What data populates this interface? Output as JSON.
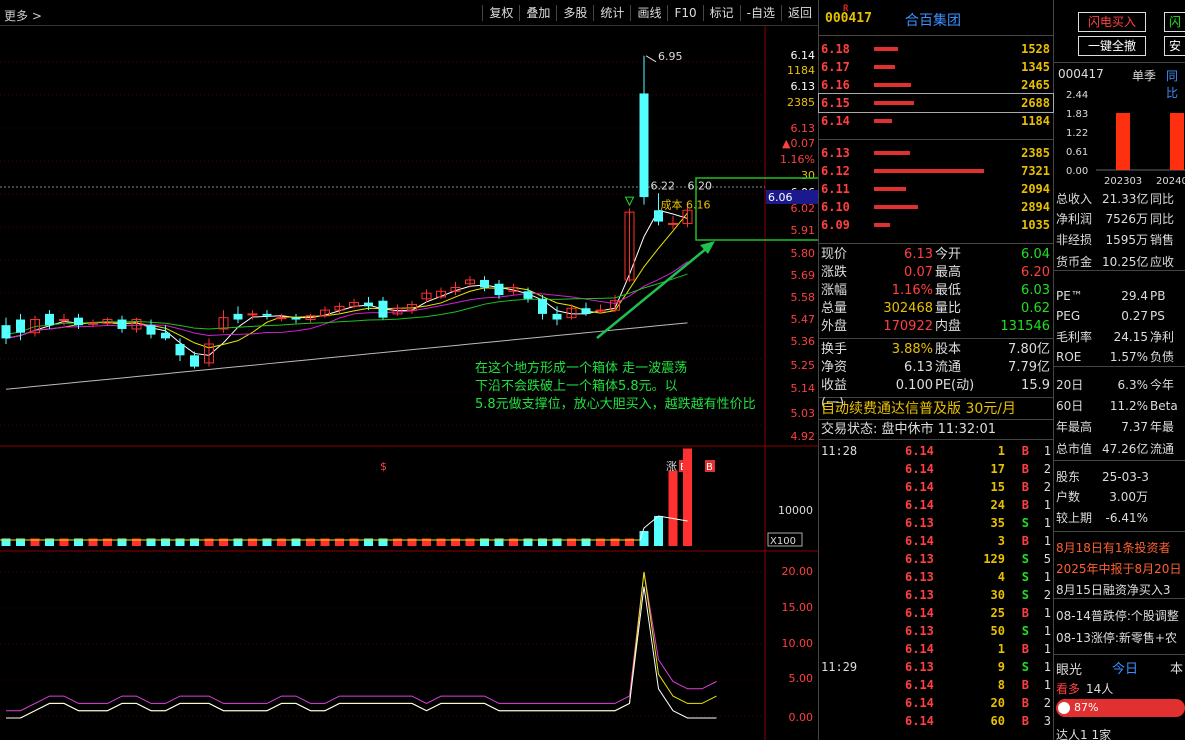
{
  "toolbar": {
    "more": "更多 >",
    "buttons": [
      "复权",
      "叠加",
      "多股",
      "统计",
      "画线",
      "F10",
      "标记",
      "-自选",
      "返回"
    ]
  },
  "chart_data": [
    {
      "type": "candlestick",
      "price_axis_ticks": [
        "6.14",
        "1184",
        "6.13",
        "2385",
        "6.13",
        "▲0.07",
        "1.16%",
        "30",
        "6.06",
        "6.02",
        "5.91",
        "5.80",
        "5.69",
        "5.58",
        "5.47",
        "5.36",
        "5.25",
        "5.14",
        "5.03",
        "4.92"
      ],
      "last_price_tag": "6.06",
      "annotations": {
        "high_label": "6.95",
        "recent_high_label": "6.22",
        "recent_high_label2": "6.20",
        "cost_label": "成本 6.16",
        "note": [
          "在这个地方形成一个箱体 走一波震荡",
          "下沿不会跌破上一个箱体5.8元。以",
          "5.8元做支撑位，放心大胆买入，越跌越有性价比"
        ],
        "markers": [
          "$",
          "涨",
          "B",
          "B"
        ]
      },
      "candles": [
        {
          "o": 5.52,
          "c": 5.45,
          "h": 5.56,
          "l": 5.42
        },
        {
          "o": 5.55,
          "c": 5.48,
          "h": 5.58,
          "l": 5.44
        },
        {
          "o": 5.48,
          "c": 5.55,
          "h": 5.57,
          "l": 5.46
        },
        {
          "o": 5.58,
          "c": 5.52,
          "h": 5.6,
          "l": 5.5
        },
        {
          "o": 5.55,
          "c": 5.55,
          "h": 5.58,
          "l": 5.52
        },
        {
          "o": 5.56,
          "c": 5.52,
          "h": 5.58,
          "l": 5.5
        },
        {
          "o": 5.53,
          "c": 5.53,
          "h": 5.55,
          "l": 5.51
        },
        {
          "o": 5.53,
          "c": 5.55,
          "h": 5.56,
          "l": 5.52
        },
        {
          "o": 5.55,
          "c": 5.5,
          "h": 5.57,
          "l": 5.48
        },
        {
          "o": 5.5,
          "c": 5.55,
          "h": 5.56,
          "l": 5.48
        },
        {
          "o": 5.52,
          "c": 5.47,
          "h": 5.55,
          "l": 5.45
        },
        {
          "o": 5.48,
          "c": 5.45,
          "h": 5.52,
          "l": 5.44
        },
        {
          "o": 5.42,
          "c": 5.36,
          "h": 5.45,
          "l": 5.33
        },
        {
          "o": 5.36,
          "c": 5.3,
          "h": 5.38,
          "l": 5.29
        },
        {
          "o": 5.32,
          "c": 5.42,
          "h": 5.45,
          "l": 5.3
        },
        {
          "o": 5.5,
          "c": 5.56,
          "h": 5.6,
          "l": 5.48
        },
        {
          "o": 5.58,
          "c": 5.55,
          "h": 5.62,
          "l": 5.53
        },
        {
          "o": 5.58,
          "c": 5.58,
          "h": 5.6,
          "l": 5.55
        },
        {
          "o": 5.58,
          "c": 5.57,
          "h": 5.6,
          "l": 5.55
        },
        {
          "o": 5.56,
          "c": 5.56,
          "h": 5.58,
          "l": 5.54
        },
        {
          "o": 5.56,
          "c": 5.55,
          "h": 5.58,
          "l": 5.53
        },
        {
          "o": 5.55,
          "c": 5.57,
          "h": 5.58,
          "l": 5.53
        },
        {
          "o": 5.57,
          "c": 5.6,
          "h": 5.62,
          "l": 5.56
        },
        {
          "o": 5.6,
          "c": 5.62,
          "h": 5.64,
          "l": 5.58
        },
        {
          "o": 5.62,
          "c": 5.64,
          "h": 5.66,
          "l": 5.61
        },
        {
          "o": 5.64,
          "c": 5.62,
          "h": 5.67,
          "l": 5.6
        },
        {
          "o": 5.65,
          "c": 5.56,
          "h": 5.67,
          "l": 5.55
        },
        {
          "o": 5.58,
          "c": 5.61,
          "h": 5.63,
          "l": 5.57
        },
        {
          "o": 5.6,
          "c": 5.63,
          "h": 5.65,
          "l": 5.58
        },
        {
          "o": 5.66,
          "c": 5.69,
          "h": 5.71,
          "l": 5.64
        },
        {
          "o": 5.67,
          "c": 5.7,
          "h": 5.72,
          "l": 5.66
        },
        {
          "o": 5.7,
          "c": 5.72,
          "h": 5.75,
          "l": 5.68
        },
        {
          "o": 5.74,
          "c": 5.76,
          "h": 5.78,
          "l": 5.72
        },
        {
          "o": 5.76,
          "c": 5.72,
          "h": 5.78,
          "l": 5.7
        },
        {
          "o": 5.74,
          "c": 5.68,
          "h": 5.76,
          "l": 5.66
        },
        {
          "o": 5.7,
          "c": 5.72,
          "h": 5.74,
          "l": 5.68
        },
        {
          "o": 5.7,
          "c": 5.66,
          "h": 5.72,
          "l": 5.64
        },
        {
          "o": 5.66,
          "c": 5.58,
          "h": 5.68,
          "l": 5.55
        },
        {
          "o": 5.58,
          "c": 5.55,
          "h": 5.62,
          "l": 5.52
        },
        {
          "o": 5.56,
          "c": 5.61,
          "h": 5.63,
          "l": 5.55
        },
        {
          "o": 5.61,
          "c": 5.58,
          "h": 5.64,
          "l": 5.57
        },
        {
          "o": 5.6,
          "c": 5.6,
          "h": 5.63,
          "l": 5.58
        },
        {
          "o": 5.6,
          "c": 5.65,
          "h": 5.68,
          "l": 5.59
        },
        {
          "o": 5.76,
          "c": 6.12,
          "h": 6.14,
          "l": 5.75
        },
        {
          "o": 6.75,
          "c": 6.2,
          "h": 6.95,
          "l": 6.16
        },
        {
          "o": 6.13,
          "c": 6.07,
          "h": 6.22,
          "l": 6.05
        },
        {
          "o": 6.06,
          "c": 6.06,
          "h": 6.1,
          "l": 6.03
        },
        {
          "o": 6.06,
          "c": 6.13,
          "h": 6.16,
          "l": 6.04
        }
      ],
      "ma_lines": [
        "white",
        "yellow",
        "magenta",
        "green",
        "gray"
      ]
    },
    {
      "type": "bar",
      "series_label": "X100",
      "axis_ticks": [
        "10000"
      ],
      "values": [
        1,
        1,
        1,
        1,
        1,
        1,
        1,
        1,
        1,
        1,
        1,
        1,
        1,
        1,
        1,
        1,
        1,
        1,
        1,
        1,
        1,
        1,
        1,
        1,
        1,
        1,
        1,
        1,
        1,
        1,
        1,
        1,
        1,
        1,
        1,
        1,
        1,
        1,
        1,
        1,
        1,
        1,
        1,
        1,
        2,
        4,
        10,
        13,
        5,
        4
      ]
    },
    {
      "type": "line",
      "axis_ticks": [
        "20.00",
        "15.00",
        "10.00",
        "5.00",
        "0.00"
      ],
      "series": [
        {
          "color": "magenta",
          "values": [
            1,
            1,
            2,
            3,
            3,
            2,
            2,
            2,
            3,
            3,
            2,
            2,
            3,
            3,
            3,
            2,
            2,
            2,
            2,
            3,
            3,
            2,
            2,
            3,
            3,
            3,
            3,
            3,
            3,
            2,
            3,
            3,
            3,
            3,
            2,
            2,
            2,
            2,
            2,
            2,
            2,
            2,
            2,
            3,
            20,
            8,
            5,
            4,
            4,
            5
          ]
        },
        {
          "color": "yellow",
          "values": [
            0,
            0,
            1,
            2,
            2,
            1,
            1,
            1,
            2,
            2,
            1,
            1,
            2,
            2,
            2,
            1,
            1,
            1,
            1,
            2,
            2,
            1,
            1,
            2,
            2,
            2,
            2,
            2,
            2,
            1,
            2,
            2,
            2,
            2,
            1,
            1,
            1,
            1,
            1,
            1,
            1,
            1,
            1,
            2,
            20,
            6,
            3,
            2,
            2,
            3
          ]
        },
        {
          "color": "white",
          "values": [
            0,
            0,
            1,
            2,
            2,
            1,
            1,
            1,
            2,
            2,
            1,
            1,
            2,
            2,
            2,
            1,
            1,
            1,
            1,
            2,
            2,
            1,
            1,
            2,
            2,
            2,
            2,
            2,
            2,
            1,
            2,
            2,
            2,
            2,
            1,
            1,
            1,
            1,
            1,
            1,
            1,
            1,
            1,
            2,
            18,
            4,
            1,
            0,
            0,
            0
          ]
        }
      ]
    }
  ],
  "quote": {
    "r_mark": "R",
    "code": "000417",
    "name": "合百集团",
    "asks": [
      {
        "price": "6.18",
        "vol": "1528",
        "bar": 24
      },
      {
        "price": "6.17",
        "vol": "1345",
        "bar": 21
      },
      {
        "price": "6.16",
        "vol": "2465",
        "bar": 37
      },
      {
        "price": "6.15",
        "vol": "2688",
        "bar": 40
      },
      {
        "price": "6.14",
        "vol": "1184",
        "bar": 18
      }
    ],
    "bids": [
      {
        "price": "6.13",
        "vol": "2385",
        "bar": 36
      },
      {
        "price": "6.12",
        "vol": "7321",
        "bar": 110
      },
      {
        "price": "6.11",
        "vol": "2094",
        "bar": 32
      },
      {
        "price": "6.10",
        "vol": "2894",
        "bar": 44
      },
      {
        "price": "6.09",
        "vol": "1035",
        "bar": 16
      }
    ],
    "stats": [
      {
        "l": "现价",
        "v": "6.13",
        "vc": "red",
        "l2": "今开",
        "v2": "6.04",
        "v2c": "green"
      },
      {
        "l": "涨跌",
        "v": "0.07",
        "vc": "red",
        "l2": "最高",
        "v2": "6.20",
        "v2c": "red"
      },
      {
        "l": "涨幅",
        "v": "1.16%",
        "vc": "red",
        "l2": "最低",
        "v2": "6.03",
        "v2c": "green"
      },
      {
        "l": "总量",
        "v": "302468",
        "vc": "yellow",
        "l2": "量比",
        "v2": "0.62",
        "v2c": "green"
      },
      {
        "l": "外盘",
        "v": "170922",
        "vc": "red",
        "l2": "内盘",
        "v2": "131546",
        "v2c": "green"
      }
    ],
    "stats2": [
      {
        "l": "换手",
        "v": "3.88%",
        "vc": "yellow",
        "l2": "股本",
        "v2": "7.80亿",
        "v2c": "white"
      },
      {
        "l": "净资",
        "v": "6.13",
        "vc": "white",
        "l2": "流通",
        "v2": "7.79亿",
        "v2c": "white"
      },
      {
        "l": "收益(一)",
        "v": "0.100",
        "vc": "white",
        "l2": "PE(动)",
        "v2": "15.9",
        "v2c": "white"
      }
    ],
    "ad": "自动续费通达信普及版  30元/月",
    "status": "交易状态: 盘中休市 11:32:01",
    "trades": [
      {
        "time": "11:28",
        "price": "6.14",
        "vol": "1",
        "side": "B",
        "n": "1"
      },
      {
        "time": "",
        "price": "6.14",
        "vol": "17",
        "side": "B",
        "n": "2"
      },
      {
        "time": "",
        "price": "6.14",
        "vol": "15",
        "side": "B",
        "n": "2"
      },
      {
        "time": "",
        "price": "6.14",
        "vol": "24",
        "side": "B",
        "n": "1"
      },
      {
        "time": "",
        "price": "6.13",
        "vol": "35",
        "side": "S",
        "n": "1"
      },
      {
        "time": "",
        "price": "6.14",
        "vol": "3",
        "side": "B",
        "n": "1"
      },
      {
        "time": "",
        "price": "6.13",
        "vol": "129",
        "side": "S",
        "n": "5"
      },
      {
        "time": "",
        "price": "6.13",
        "vol": "4",
        "side": "S",
        "n": "1"
      },
      {
        "time": "",
        "price": "6.13",
        "vol": "30",
        "side": "S",
        "n": "2"
      },
      {
        "time": "",
        "price": "6.14",
        "vol": "25",
        "side": "B",
        "n": "1"
      },
      {
        "time": "",
        "price": "6.13",
        "vol": "50",
        "side": "S",
        "n": "1"
      },
      {
        "time": "",
        "price": "6.14",
        "vol": "1",
        "side": "B",
        "n": "1"
      },
      {
        "time": "11:29",
        "price": "6.13",
        "vol": "9",
        "side": "S",
        "n": "1"
      },
      {
        "time": "",
        "price": "6.14",
        "vol": "8",
        "side": "B",
        "n": "1"
      },
      {
        "time": "",
        "price": "6.14",
        "vol": "20",
        "side": "B",
        "n": "2"
      },
      {
        "time": "",
        "price": "6.14",
        "vol": "60",
        "side": "B",
        "n": "3"
      }
    ]
  },
  "info": {
    "flash_buy": "闪电买入",
    "cancel_all": "一键全撤",
    "btn_partial1": "闪",
    "btn_partial2": "安",
    "code": "000417",
    "tab1": "单季",
    "tab2": "同比",
    "mini_chart": {
      "ticks": [
        "2.44",
        "1.83",
        "1.22",
        "0.61",
        "0.00"
      ],
      "x_labels": [
        "202303",
        "20240"
      ],
      "values": [
        1.83,
        1.83
      ]
    },
    "kv": [
      {
        "k": "总收入",
        "v": "21.33亿",
        "t": "同比"
      },
      {
        "k": "净利润",
        "v": "7526万",
        "t": "同比"
      },
      {
        "k": "非经损",
        "v": "1595万",
        "t": "销售"
      },
      {
        "k": "货币金",
        "v": "10.25亿",
        "t": "应收"
      },
      {
        "k": "PE™",
        "v": "29.4",
        "t": "PB"
      },
      {
        "k": "PEG",
        "v": "0.27",
        "t": "PS"
      },
      {
        "k": "毛利率",
        "v": "24.15",
        "t": "净利"
      },
      {
        "k": "ROE",
        "v": "1.57%",
        "t": "负债"
      },
      {
        "k": "20日",
        "v": "6.3%",
        "t": "今年"
      },
      {
        "k": "60日",
        "v": "11.2%",
        "t": "Beta"
      },
      {
        "k": "年最高",
        "v": "7.37",
        "t": "年最"
      },
      {
        "k": "总市值",
        "v": "47.26亿",
        "t": "流通"
      },
      {
        "k": "股东",
        "v": "25-03-3",
        "t": ""
      },
      {
        "k": "户数",
        "v": "3.00万",
        "t": ""
      },
      {
        "k": "较上期",
        "v": "-6.41%",
        "t": ""
      }
    ],
    "news": [
      {
        "text": "8月18日有1条投资者",
        "color": "#ff6030"
      },
      {
        "text": "2025年中报于8月20日",
        "color": "#ff6030"
      },
      {
        "text": "8月15日融资净买入3",
        "color": "#ddd"
      },
      {
        "text": "08-14普跌停:个股调整",
        "color": "#ddd"
      },
      {
        "text": "08-13涨停:新零售+农",
        "color": "#ddd"
      }
    ],
    "eye": "眼光",
    "today": "今日",
    "today2": "本",
    "bullish": "看多",
    "bullish_count": "14人",
    "pct": "87%",
    "footer": "达人1  1家"
  }
}
